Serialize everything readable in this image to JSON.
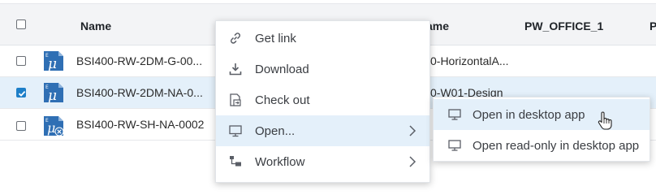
{
  "table": {
    "columns": [
      "Name",
      "ame",
      "PW_OFFICE_1",
      "P"
    ],
    "rows": [
      {
        "name": "BSI400-RW-2DM-G-00...",
        "col2": "0-HorizontalA...",
        "checked": false,
        "selected": false,
        "icon": "microstation-file-icon"
      },
      {
        "name": "BSI400-RW-2DM-NA-0...",
        "col2": "0-W01-Design",
        "checked": true,
        "selected": true,
        "icon": "microstation-file-icon"
      },
      {
        "name": "BSI400-RW-SH-NA-0002",
        "col2": "",
        "checked": false,
        "selected": false,
        "icon": "microstation-file-checked-out-icon"
      }
    ]
  },
  "context_menu": {
    "items": [
      {
        "label": "Get link",
        "icon": "link-icon"
      },
      {
        "label": "Download",
        "icon": "download-icon"
      },
      {
        "label": "Check out",
        "icon": "check-out-icon"
      },
      {
        "label": "Open...",
        "icon": "monitor-icon",
        "has_submenu": true,
        "active": true
      },
      {
        "label": "Workflow",
        "icon": "workflow-icon",
        "has_submenu": true
      }
    ]
  },
  "submenu": {
    "items": [
      {
        "label": "Open in desktop app",
        "icon": "monitor-icon",
        "hover": true
      },
      {
        "label": "Open read-only in desktop app",
        "icon": "monitor-icon"
      }
    ]
  },
  "colors": {
    "accent": "#1e7fc8",
    "selected_row": "#e4f0fa",
    "header_bg": "#f3f4f6"
  }
}
